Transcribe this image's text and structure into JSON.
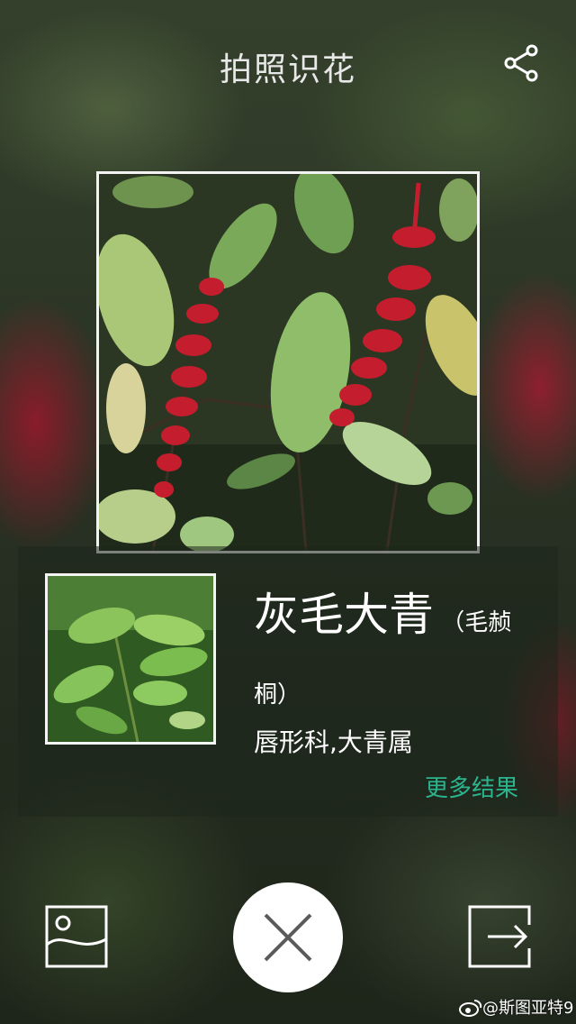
{
  "header": {
    "title": "拍照识花",
    "share_icon": "share-icon"
  },
  "result": {
    "name_main": "灰毛大青",
    "name_alt": "（毛赪桐）",
    "family": "唇形科,大青属",
    "more_label": "更多结果",
    "more_color": "#2bb58e"
  },
  "toolbar": {
    "gallery_icon": "image-gallery-icon",
    "close_icon": "close-icon",
    "exit_icon": "exit-arrow-icon"
  },
  "watermark": {
    "text": "@斯图亚特9",
    "icon": "weibo-icon"
  }
}
